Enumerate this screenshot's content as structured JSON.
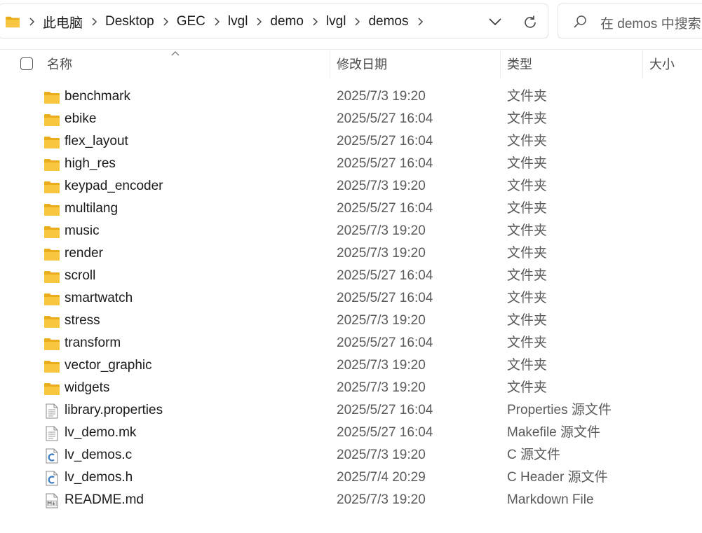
{
  "breadcrumb": [
    "此电脑",
    "Desktop",
    "GEC",
    "lvgl",
    "demo",
    "lvgl",
    "demos"
  ],
  "search": {
    "placeholder": "在 demos 中搜索"
  },
  "columns": {
    "name": "名称",
    "date": "修改日期",
    "type": "类型",
    "size": "大小"
  },
  "files": [
    {
      "name": "benchmark",
      "date": "2025/7/3 19:20",
      "type": "文件夹",
      "icon": "folder-icon"
    },
    {
      "name": "ebike",
      "date": "2025/5/27 16:04",
      "type": "文件夹",
      "icon": "folder-icon"
    },
    {
      "name": "flex_layout",
      "date": "2025/5/27 16:04",
      "type": "文件夹",
      "icon": "folder-icon"
    },
    {
      "name": "high_res",
      "date": "2025/5/27 16:04",
      "type": "文件夹",
      "icon": "folder-icon"
    },
    {
      "name": "keypad_encoder",
      "date": "2025/7/3 19:20",
      "type": "文件夹",
      "icon": "folder-icon"
    },
    {
      "name": "multilang",
      "date": "2025/5/27 16:04",
      "type": "文件夹",
      "icon": "folder-icon"
    },
    {
      "name": "music",
      "date": "2025/7/3 19:20",
      "type": "文件夹",
      "icon": "folder-icon"
    },
    {
      "name": "render",
      "date": "2025/7/3 19:20",
      "type": "文件夹",
      "icon": "folder-icon"
    },
    {
      "name": "scroll",
      "date": "2025/5/27 16:04",
      "type": "文件夹",
      "icon": "folder-icon"
    },
    {
      "name": "smartwatch",
      "date": "2025/5/27 16:04",
      "type": "文件夹",
      "icon": "folder-icon"
    },
    {
      "name": "stress",
      "date": "2025/7/3 19:20",
      "type": "文件夹",
      "icon": "folder-icon"
    },
    {
      "name": "transform",
      "date": "2025/5/27 16:04",
      "type": "文件夹",
      "icon": "folder-icon"
    },
    {
      "name": "vector_graphic",
      "date": "2025/7/3 19:20",
      "type": "文件夹",
      "icon": "folder-icon"
    },
    {
      "name": "widgets",
      "date": "2025/7/3 19:20",
      "type": "文件夹",
      "icon": "folder-icon"
    },
    {
      "name": "library.properties",
      "date": "2025/5/27 16:04",
      "type": "Properties 源文件",
      "icon": "text-file-icon"
    },
    {
      "name": "lv_demo.mk",
      "date": "2025/5/27 16:04",
      "type": "Makefile 源文件",
      "icon": "text-file-icon"
    },
    {
      "name": "lv_demos.c",
      "date": "2025/7/3 19:20",
      "type": "C 源文件",
      "icon": "c-source-icon"
    },
    {
      "name": "lv_demos.h",
      "date": "2025/7/4 20:29",
      "type": "C Header 源文件",
      "icon": "c-header-icon"
    },
    {
      "name": "README.md",
      "date": "2025/7/3 19:20",
      "type": "Markdown File",
      "icon": "markdown-icon"
    }
  ],
  "colors": {
    "folder": "#f8c640",
    "folder_dark": "#e9ad1c",
    "c_icon": "#3b7bbf"
  }
}
